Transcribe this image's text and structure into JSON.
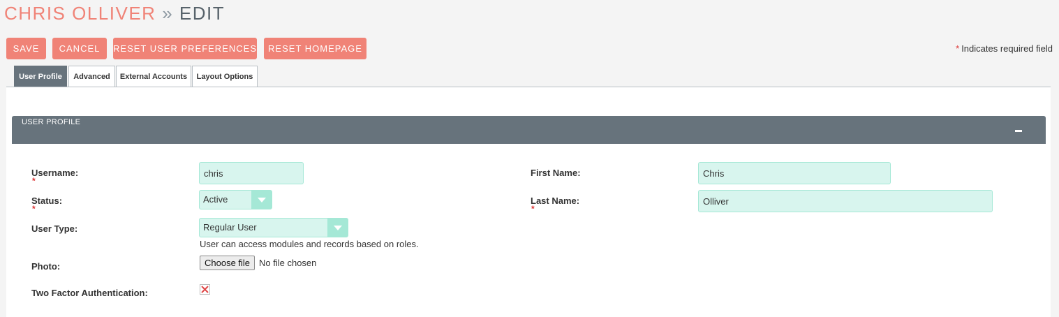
{
  "title": {
    "name": "CHRIS OLLIVER",
    "separator": "»",
    "action": "EDIT"
  },
  "actions": {
    "save": "SAVE",
    "cancel": "CANCEL",
    "reset_prefs": "RESET USER PREFERENCES",
    "reset_home": "RESET HOMEPAGE"
  },
  "required_note": {
    "star": "*",
    "text": "Indicates required field"
  },
  "tabs": [
    {
      "label": "User Profile",
      "active": true
    },
    {
      "label": "Advanced",
      "active": false
    },
    {
      "label": "External Accounts",
      "active": false
    },
    {
      "label": "Layout Options",
      "active": false
    }
  ],
  "panel": {
    "title": "USER PROFILE",
    "collapse_icon": "minus-icon"
  },
  "form": {
    "username": {
      "label": "Username:",
      "value": "chris",
      "required": true
    },
    "status": {
      "label": "Status:",
      "value": "Active",
      "required": true
    },
    "user_type": {
      "label": "User Type:",
      "value": "Regular User",
      "helper": "User can access modules and records based on roles."
    },
    "photo": {
      "label": "Photo:",
      "button": "Choose file",
      "status": "No file chosen"
    },
    "two_factor": {
      "label": "Two Factor Authentication:",
      "checked": false,
      "icon": "x-mark-icon"
    },
    "first_name": {
      "label": "First Name:",
      "value": "Chris",
      "required": false
    },
    "last_name": {
      "label": "Last Name:",
      "value": "Olliver",
      "required": true
    }
  },
  "colors": {
    "accent": "#f08377",
    "header": "#67737c",
    "input_bg": "#d8f5ee",
    "input_border": "#a5e8d6",
    "required": "#dd3333"
  }
}
